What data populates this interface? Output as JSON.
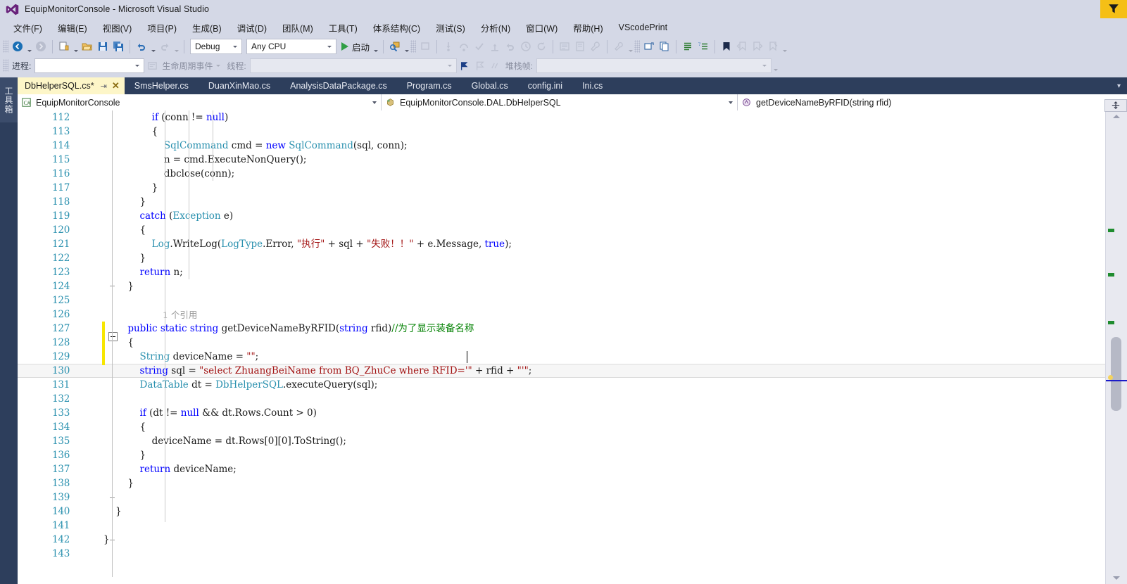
{
  "window": {
    "title": "EquipMonitorConsole - Microsoft Visual Studio",
    "logo_name": "visual-studio-logo",
    "filter_button_label": ""
  },
  "menu": {
    "items": [
      {
        "label": "文件(F)"
      },
      {
        "label": "编辑(E)"
      },
      {
        "label": "视图(V)"
      },
      {
        "label": "项目(P)"
      },
      {
        "label": "生成(B)"
      },
      {
        "label": "调试(D)"
      },
      {
        "label": "团队(M)"
      },
      {
        "label": "工具(T)"
      },
      {
        "label": "体系结构(C)"
      },
      {
        "label": "测试(S)"
      },
      {
        "label": "分析(N)"
      },
      {
        "label": "窗口(W)"
      },
      {
        "label": "帮助(H)"
      },
      {
        "label": "VScodePrint"
      }
    ]
  },
  "toolbar": {
    "configuration": "Debug",
    "platform": "Any CPU",
    "start_label": "启动"
  },
  "debugbar": {
    "process_label": "进程:",
    "process_value": "",
    "lifecycle_label": "生命周期事件",
    "thread_label": "线程:",
    "thread_value": "",
    "stackframe_label": "堆栈帧:",
    "stackframe_value": ""
  },
  "leftdock": {
    "toolbox_label": "工具箱"
  },
  "tabs": [
    {
      "label": "DbHelperSQL.cs*",
      "active": true,
      "modified": true
    },
    {
      "label": "SmsHelper.cs",
      "active": false
    },
    {
      "label": "DuanXinMao.cs",
      "active": false
    },
    {
      "label": "AnalysisDataPackage.cs",
      "active": false
    },
    {
      "label": "Program.cs",
      "active": false
    },
    {
      "label": "Global.cs",
      "active": false
    },
    {
      "label": "config.ini",
      "active": false
    },
    {
      "label": "Ini.cs",
      "active": false
    }
  ],
  "navbar": {
    "project": "EquipMonitorConsole",
    "type": "EquipMonitorConsole.DAL.DbHelperSQL",
    "member": "getDeviceNameByRFID(string rfid)"
  },
  "editor": {
    "first_line": 112,
    "current_line": 130,
    "code_lens": "1 个引用",
    "lines": [
      {
        "n": 112,
        "tokens": [
          {
            "t": "                ",
            "c": "pl"
          },
          {
            "t": "if",
            "c": "kw"
          },
          {
            "t": " (conn != ",
            "c": "pl"
          },
          {
            "t": "null",
            "c": "kw"
          },
          {
            "t": ")",
            "c": "pl"
          }
        ]
      },
      {
        "n": 113,
        "tokens": [
          {
            "t": "                {",
            "c": "pl"
          }
        ]
      },
      {
        "n": 114,
        "tokens": [
          {
            "t": "                    ",
            "c": "pl"
          },
          {
            "t": "SqlCommand",
            "c": "ty"
          },
          {
            "t": " cmd = ",
            "c": "pl"
          },
          {
            "t": "new",
            "c": "kw"
          },
          {
            "t": " ",
            "c": "pl"
          },
          {
            "t": "SqlCommand",
            "c": "ty"
          },
          {
            "t": "(sql, conn);",
            "c": "pl"
          }
        ]
      },
      {
        "n": 115,
        "tokens": [
          {
            "t": "                    n = cmd.ExecuteNonQuery();",
            "c": "pl"
          }
        ]
      },
      {
        "n": 116,
        "tokens": [
          {
            "t": "                    dbclose(conn);",
            "c": "pl"
          }
        ]
      },
      {
        "n": 117,
        "tokens": [
          {
            "t": "                }",
            "c": "pl"
          }
        ]
      },
      {
        "n": 118,
        "tokens": [
          {
            "t": "            }",
            "c": "pl"
          }
        ]
      },
      {
        "n": 119,
        "tokens": [
          {
            "t": "            ",
            "c": "pl"
          },
          {
            "t": "catch",
            "c": "kw"
          },
          {
            "t": " (",
            "c": "pl"
          },
          {
            "t": "Exception",
            "c": "ty"
          },
          {
            "t": " e)",
            "c": "pl"
          }
        ]
      },
      {
        "n": 120,
        "tokens": [
          {
            "t": "            {",
            "c": "pl"
          }
        ]
      },
      {
        "n": 121,
        "tokens": [
          {
            "t": "                ",
            "c": "pl"
          },
          {
            "t": "Log",
            "c": "ty"
          },
          {
            "t": ".WriteLog(",
            "c": "pl"
          },
          {
            "t": "LogType",
            "c": "ty"
          },
          {
            "t": ".Error, ",
            "c": "pl"
          },
          {
            "t": "\"执行\"",
            "c": "str"
          },
          {
            "t": " + sql + ",
            "c": "pl"
          },
          {
            "t": "\"失败！！\"",
            "c": "str"
          },
          {
            "t": " + e.Message, ",
            "c": "pl"
          },
          {
            "t": "true",
            "c": "kw"
          },
          {
            "t": ");",
            "c": "pl"
          }
        ]
      },
      {
        "n": 122,
        "tokens": [
          {
            "t": "            }",
            "c": "pl"
          }
        ]
      },
      {
        "n": 123,
        "tokens": [
          {
            "t": "            ",
            "c": "pl"
          },
          {
            "t": "return",
            "c": "kw"
          },
          {
            "t": " n;",
            "c": "pl"
          }
        ]
      },
      {
        "n": 124,
        "tokens": [
          {
            "t": "        }",
            "c": "pl"
          }
        ]
      },
      {
        "n": 125,
        "tokens": [
          {
            "t": "",
            "c": "pl"
          }
        ]
      },
      {
        "n": 126,
        "tokens": [
          {
            "t": "",
            "c": "pl"
          }
        ]
      },
      {
        "n": 127,
        "tokens": [
          {
            "t": "        ",
            "c": "pl"
          },
          {
            "t": "public",
            "c": "kw"
          },
          {
            "t": " ",
            "c": "pl"
          },
          {
            "t": "static",
            "c": "kw"
          },
          {
            "t": " ",
            "c": "pl"
          },
          {
            "t": "string",
            "c": "kw"
          },
          {
            "t": " getDeviceNameByRFID(",
            "c": "pl"
          },
          {
            "t": "string",
            "c": "kw"
          },
          {
            "t": " rfid)",
            "c": "pl"
          },
          {
            "t": "//为了显示装备名称",
            "c": "cmt"
          }
        ]
      },
      {
        "n": 128,
        "tokens": [
          {
            "t": "        {",
            "c": "pl"
          }
        ]
      },
      {
        "n": 129,
        "tokens": [
          {
            "t": "            ",
            "c": "pl"
          },
          {
            "t": "String",
            "c": "ty"
          },
          {
            "t": " deviceName = ",
            "c": "pl"
          },
          {
            "t": "\"\"",
            "c": "str"
          },
          {
            "t": ";",
            "c": "pl"
          }
        ]
      },
      {
        "n": 130,
        "tokens": [
          {
            "t": "            ",
            "c": "pl"
          },
          {
            "t": "string",
            "c": "kw"
          },
          {
            "t": " sql = ",
            "c": "pl"
          },
          {
            "t": "\"select ZhuangBeiName from BQ_ZhuCe where RFID='\"",
            "c": "str"
          },
          {
            "t": " + rfid + ",
            "c": "pl"
          },
          {
            "t": "\"'\"",
            "c": "str"
          },
          {
            "t": ";",
            "c": "pl"
          }
        ]
      },
      {
        "n": 131,
        "tokens": [
          {
            "t": "            ",
            "c": "pl"
          },
          {
            "t": "DataTable",
            "c": "ty"
          },
          {
            "t": " dt = ",
            "c": "pl"
          },
          {
            "t": "DbHelperSQL",
            "c": "ty"
          },
          {
            "t": ".executeQuery(sql);",
            "c": "pl"
          }
        ]
      },
      {
        "n": 132,
        "tokens": [
          {
            "t": "",
            "c": "pl"
          }
        ]
      },
      {
        "n": 133,
        "tokens": [
          {
            "t": "            ",
            "c": "pl"
          },
          {
            "t": "if",
            "c": "kw"
          },
          {
            "t": " (dt != ",
            "c": "pl"
          },
          {
            "t": "null",
            "c": "kw"
          },
          {
            "t": " && dt.Rows.Count > 0)",
            "c": "pl"
          }
        ]
      },
      {
        "n": 134,
        "tokens": [
          {
            "t": "            {",
            "c": "pl"
          }
        ]
      },
      {
        "n": 135,
        "tokens": [
          {
            "t": "                deviceName = dt.Rows[0][0].ToString();",
            "c": "pl"
          }
        ]
      },
      {
        "n": 136,
        "tokens": [
          {
            "t": "            }",
            "c": "pl"
          }
        ]
      },
      {
        "n": 137,
        "tokens": [
          {
            "t": "            ",
            "c": "pl"
          },
          {
            "t": "return",
            "c": "kw"
          },
          {
            "t": " deviceName;",
            "c": "pl"
          }
        ]
      },
      {
        "n": 138,
        "tokens": [
          {
            "t": "        }",
            "c": "pl"
          }
        ]
      },
      {
        "n": 139,
        "tokens": [
          {
            "t": "",
            "c": "pl"
          }
        ]
      },
      {
        "n": 140,
        "tokens": [
          {
            "t": "    }",
            "c": "pl"
          }
        ]
      },
      {
        "n": 141,
        "tokens": [
          {
            "t": "",
            "c": "pl"
          }
        ]
      },
      {
        "n": 142,
        "tokens": [
          {
            "t": "}",
            "c": "pl"
          }
        ]
      },
      {
        "n": 143,
        "tokens": [
          {
            "t": "",
            "c": "pl"
          }
        ]
      }
    ]
  },
  "colors": {
    "chrome": "#d4d8e6",
    "tabstrip": "#2d3e5c",
    "active_tab": "#fdf6c8",
    "accent_yellow": "#f5bf16",
    "keyword": "#0000ff",
    "type": "#2b91af",
    "string": "#a31515",
    "comment": "#008000",
    "linenumber": "#2b91af",
    "change_marker": "#f7e600",
    "scroll_change": "#1f8c2f"
  }
}
